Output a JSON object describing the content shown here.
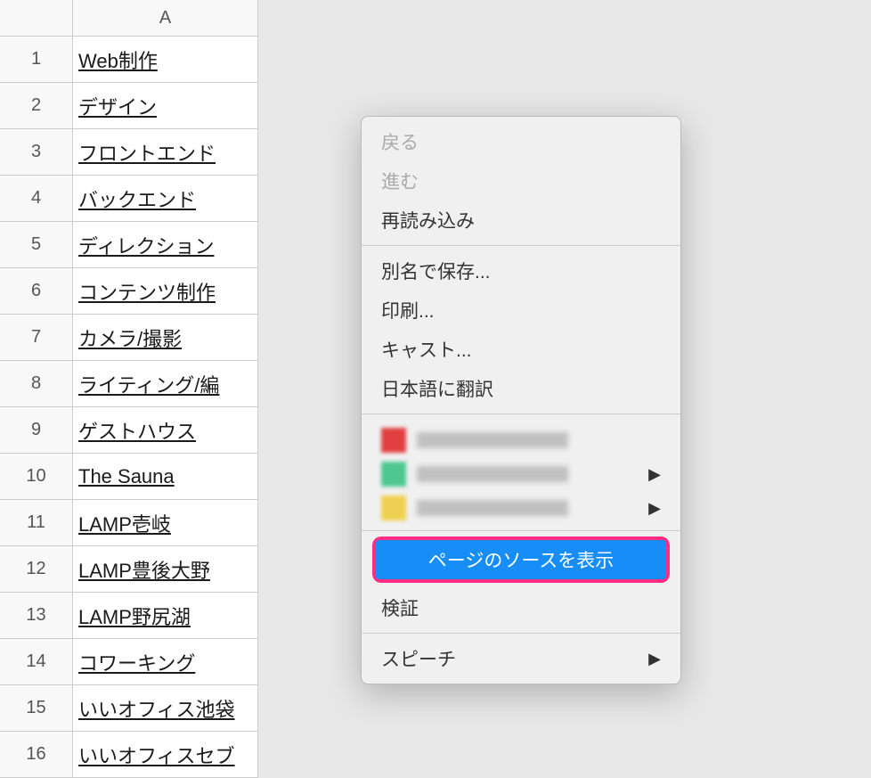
{
  "spreadsheet": {
    "column_header": "A",
    "rows": [
      {
        "num": "1",
        "value": "Web制作"
      },
      {
        "num": "2",
        "value": "デザイン"
      },
      {
        "num": "3",
        "value": "フロントエンド"
      },
      {
        "num": "4",
        "value": "バックエンド"
      },
      {
        "num": "5",
        "value": "ディレクション"
      },
      {
        "num": "6",
        "value": "コンテンツ制作"
      },
      {
        "num": "7",
        "value": "カメラ/撮影"
      },
      {
        "num": "8",
        "value": "ライティング/編"
      },
      {
        "num": "9",
        "value": "ゲストハウス"
      },
      {
        "num": "10",
        "value": "The Sauna"
      },
      {
        "num": "11",
        "value": "LAMP壱岐"
      },
      {
        "num": "12",
        "value": "LAMP豊後大野"
      },
      {
        "num": "13",
        "value": "LAMP野尻湖"
      },
      {
        "num": "14",
        "value": "コワーキング"
      },
      {
        "num": "15",
        "value": "いいオフィス池袋"
      },
      {
        "num": "16",
        "value": "いいオフィスセブ"
      }
    ]
  },
  "context_menu": {
    "back": "戻る",
    "forward": "進む",
    "reload": "再読み込み",
    "save_as": "別名で保存...",
    "print": "印刷...",
    "cast": "キャスト...",
    "translate": "日本語に翻訳",
    "view_source": "ページのソースを表示",
    "inspect": "検証",
    "speech": "スピーチ",
    "arrow": "▶"
  }
}
